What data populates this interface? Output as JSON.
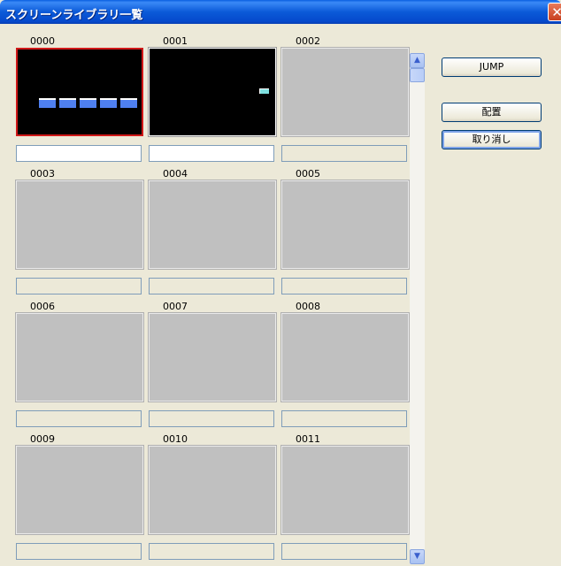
{
  "window": {
    "title": "スクリーンライブラリ一覧",
    "close_label": "✕"
  },
  "buttons": {
    "jump": "JUMP",
    "place": "配置",
    "cancel": "取り消し"
  },
  "cells": [
    {
      "label": "0000",
      "preview": "blocks",
      "selected": true,
      "name": ""
    },
    {
      "label": "0001",
      "preview": "mini",
      "selected": false,
      "name": ""
    },
    {
      "label": "0002",
      "preview": "empty",
      "selected": false,
      "name": ""
    },
    {
      "label": "0003",
      "preview": "empty",
      "selected": false,
      "name": ""
    },
    {
      "label": "0004",
      "preview": "empty",
      "selected": false,
      "name": ""
    },
    {
      "label": "0005",
      "preview": "empty",
      "selected": false,
      "name": ""
    },
    {
      "label": "0006",
      "preview": "empty",
      "selected": false,
      "name": ""
    },
    {
      "label": "0007",
      "preview": "empty",
      "selected": false,
      "name": ""
    },
    {
      "label": "0008",
      "preview": "empty",
      "selected": false,
      "name": ""
    },
    {
      "label": "0009",
      "preview": "empty",
      "selected": false,
      "name": ""
    },
    {
      "label": "0010",
      "preview": "empty",
      "selected": false,
      "name": ""
    },
    {
      "label": "0011",
      "preview": "empty",
      "selected": false,
      "name": ""
    }
  ],
  "scrollbar": {
    "up_icon": "chevron-up-icon",
    "down_icon": "chevron-down-icon"
  }
}
